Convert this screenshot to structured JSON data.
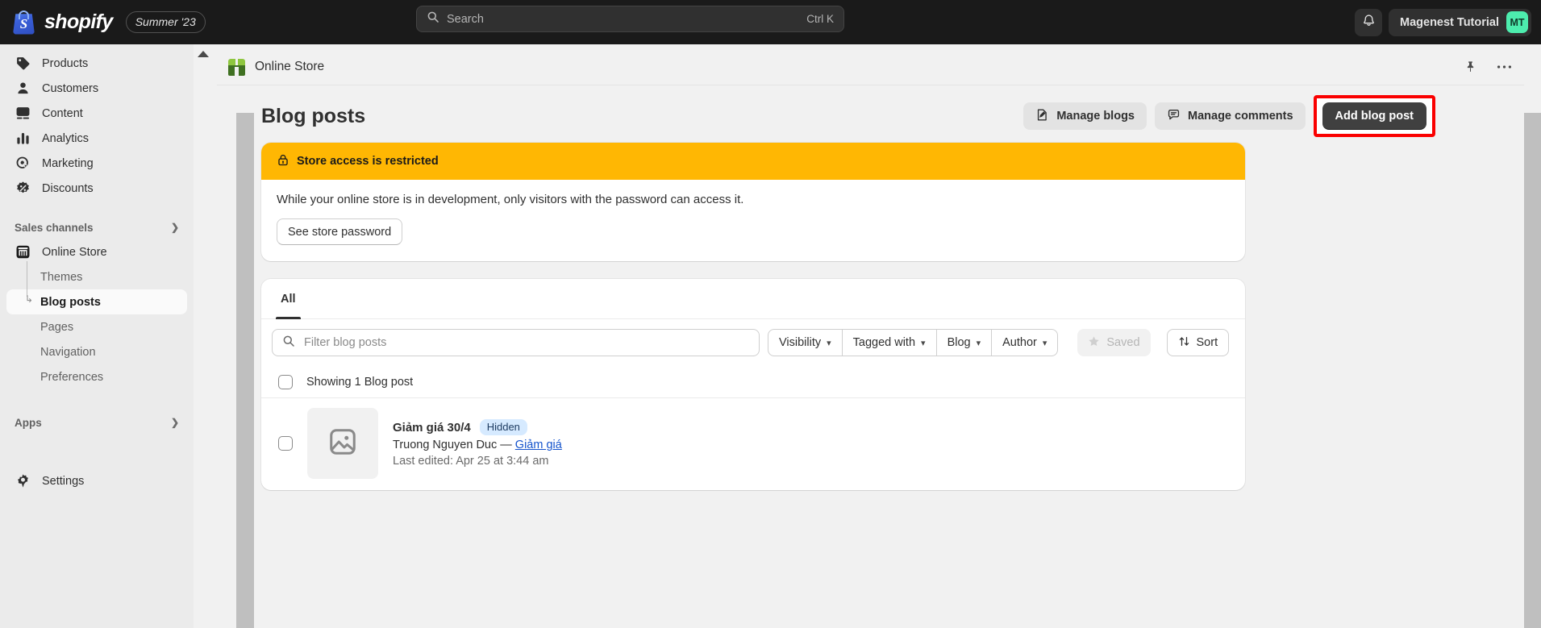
{
  "topbar": {
    "brand_word": "shopify",
    "brand_mark_letter": "S",
    "release_badge": "Summer '23",
    "search_placeholder": "Search",
    "search_shortcut": "Ctrl K",
    "notifications_icon": "bell-icon",
    "account_name": "Magenest Tutorial",
    "account_initials": "MT",
    "avatar_color": "#4dedae"
  },
  "sidebar": {
    "items": [
      {
        "label": "Products",
        "icon": "tag-icon"
      },
      {
        "label": "Customers",
        "icon": "person-icon"
      },
      {
        "label": "Content",
        "icon": "image-content-icon"
      },
      {
        "label": "Analytics",
        "icon": "bar-chart-icon"
      },
      {
        "label": "Marketing",
        "icon": "target-cursor-icon"
      },
      {
        "label": "Discounts",
        "icon": "discount-badge-icon"
      }
    ],
    "sales_channels_label": "Sales channels",
    "online_store_label": "Online Store",
    "sub_items": [
      {
        "label": "Themes"
      },
      {
        "label": "Blog posts"
      },
      {
        "label": "Pages"
      },
      {
        "label": "Navigation"
      },
      {
        "label": "Preferences"
      }
    ],
    "apps_label": "Apps",
    "settings_label": "Settings"
  },
  "store_header": {
    "title": "Online Store",
    "pin_icon": "pin-icon",
    "more_icon": "ellipsis-icon"
  },
  "page": {
    "title": "Blog posts",
    "actions": {
      "manage_blogs": "Manage blogs",
      "manage_comments": "Manage comments",
      "add_blog_post": "Add blog post"
    },
    "highlight_color": "#fa0000"
  },
  "banner": {
    "title": "Store access is restricted",
    "lock_icon": "lock-icon",
    "body": "While your online store is in development, only visitors with the password can access it.",
    "button": "See store password",
    "accent": "#ffb703"
  },
  "list": {
    "tabs": [
      {
        "label": "All",
        "active": true
      }
    ],
    "filter_placeholder": "Filter blog posts",
    "pills": [
      {
        "label": "Visibility"
      },
      {
        "label": "Tagged with"
      },
      {
        "label": "Blog"
      },
      {
        "label": "Author"
      }
    ],
    "saved_label": "Saved",
    "sort_label": "Sort",
    "showing_label": "Showing 1 Blog post",
    "rows": [
      {
        "title": "Giảm giá 30/4",
        "badge": "Hidden",
        "author": "Truong Nguyen Duc —",
        "blog_link": "Giảm giá",
        "last_edited": "Last edited: Apr 25 at 3:44 am"
      }
    ]
  }
}
